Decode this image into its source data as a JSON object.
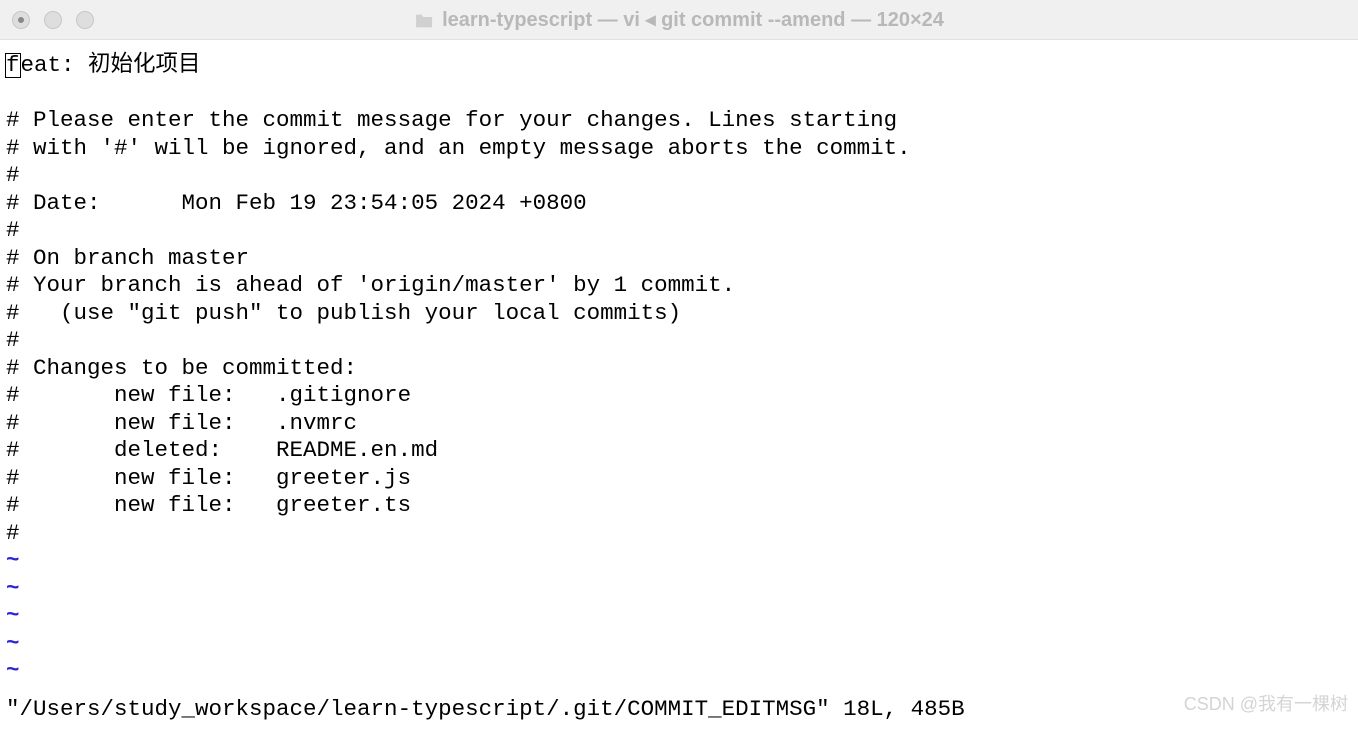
{
  "window": {
    "title": "learn-typescript — vi ◂ git commit --amend — 120×24"
  },
  "editor": {
    "commit_message_first_char": "f",
    "commit_message_rest": "eat: 初始化项目",
    "lines": [
      "",
      "# Please enter the commit message for your changes. Lines starting",
      "# with '#' will be ignored, and an empty message aborts the commit.",
      "#",
      "# Date:      Mon Feb 19 23:54:05 2024 +0800",
      "#",
      "# On branch master",
      "# Your branch is ahead of 'origin/master' by 1 commit.",
      "#   (use \"git push\" to publish your local commits)",
      "#",
      "# Changes to be committed:",
      "#       new file:   .gitignore",
      "#       new file:   .nvmrc",
      "#       deleted:    README.en.md",
      "#       new file:   greeter.js",
      "#       new file:   greeter.ts",
      "#"
    ],
    "tilde": "~",
    "tilde_count": 5,
    "status": "\"/Users/study_workspace/learn-typescript/.git/COMMIT_EDITMSG\" 18L, 485B"
  },
  "watermark": "CSDN @我有一棵树"
}
